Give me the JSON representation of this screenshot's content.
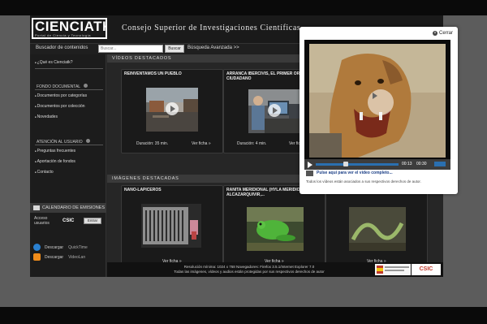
{
  "header": {
    "logo_text": "CIENCIATK",
    "logo_sub": "Portal de Ciencia y Tecnología",
    "title": "Consejo Superior de Investigaciones Científicas"
  },
  "search": {
    "label": "Buscador de contenidos",
    "placeholder": "Buscar...",
    "button": "Buscar",
    "advanced": "Búsqueda Avanzada >>"
  },
  "sidebar": {
    "about": "¿Qué es Cienciatk?",
    "fondo_title": "FONDO DOCUMENTAL",
    "fondo_items": [
      "Documentos por categorías",
      "Documentos por colección",
      "Novedades"
    ],
    "atencion_title": "ATENCIÓN AL USUARIO",
    "atencion_items": [
      "Preguntas frecuentes",
      "Aportación de fondos",
      "Contacto"
    ],
    "calendar": "CALENDARIO DE EMISIONES",
    "access_label": "Acceso usuarios",
    "access_org": "CSIC",
    "enter_button": "Entrar",
    "downloads": [
      {
        "label": "Descargar",
        "app": "QuickTime"
      },
      {
        "label": "Descargar",
        "app": "VideoLan"
      }
    ]
  },
  "videos_section": "VÍDEOS DESTACADOS",
  "videos": [
    {
      "title": "REINVENTAMOS UN PUEBLO",
      "duration": "Duración: 35 min.",
      "link": "Ver ficha »"
    },
    {
      "title": "ARRANCA IBERCIVIS, EL PRIMER ORDENADOR CIUDADANO",
      "duration": "Duración: 4 min.",
      "link": "Ver ficha »"
    }
  ],
  "images_section": "IMÁGENES DESTACADAS",
  "images": [
    {
      "title": "NANO-LAPICEROS",
      "link": "Ver ficha »"
    },
    {
      "title": "RANITA MERIDIONAL (HYLA MERIDIONALIS) EN ALCAZARQUIVIR,...",
      "link": "Ver ficha »"
    },
    {
      "title": "",
      "link": "Ver ficha »"
    }
  ],
  "footer": {
    "line1": "Resolución mínima: 1024 x 768 Navegadores: Firefox 3.5.1/Internet Explorer 7.0",
    "line2": "Todas las imágenes, vídeos y audios están protegidas por sus respectivos derechos de autor",
    "logo_right": "CSIC"
  },
  "modal": {
    "close": "Cerrar",
    "time_current": "00:13",
    "time_total": "00:30",
    "caption": "Pulse aquí para ver el vídeo completo...",
    "rights": "Todos los vídeos están asociados a sus respectivos derechos de autor."
  }
}
